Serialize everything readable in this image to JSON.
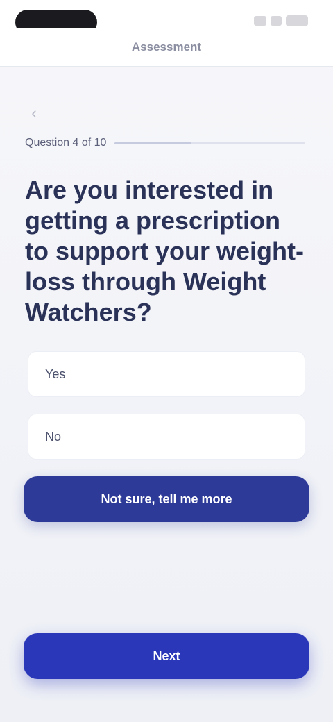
{
  "header": {
    "title": "Assessment"
  },
  "progress": {
    "label": "Question 4 of 10",
    "fraction": 0.4
  },
  "question": {
    "text": "Are you interested in getting a prescription to support your weight-loss through Weight Watchers?"
  },
  "options": [
    {
      "label": "Yes"
    },
    {
      "label": "No"
    }
  ],
  "buttons": {
    "secondary_label": "Not sure, tell me more",
    "primary_label": "Next"
  },
  "colors": {
    "accent": "#2a37b8",
    "secondary": "#2d3a98",
    "text": "#2a3258"
  }
}
